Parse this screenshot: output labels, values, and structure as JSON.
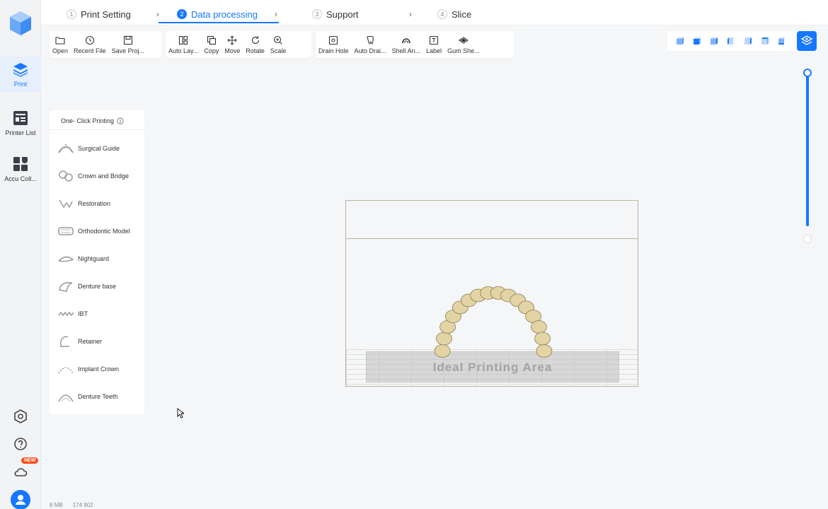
{
  "sidebar": {
    "items": [
      {
        "label": "Print",
        "icon": "print-layers-icon",
        "active": true
      },
      {
        "label": "Printer List",
        "icon": "printer-list-icon",
        "active": false
      },
      {
        "label": "Accu Coll...",
        "icon": "accu-collection-icon",
        "active": false
      }
    ],
    "bottom_icons": [
      "settings-icon",
      "help-icon",
      "cloud-icon",
      "user-avatar-icon"
    ],
    "new_badge": "NEW"
  },
  "steps": [
    {
      "num": "1",
      "label": "Print Setting",
      "active": false
    },
    {
      "num": "2",
      "label": "Data processing",
      "active": true
    },
    {
      "num": "3",
      "label": "Support",
      "active": false
    },
    {
      "num": "4",
      "label": "Slice",
      "active": false
    }
  ],
  "toolbar": {
    "group1": [
      {
        "label": "Open",
        "icon": "folder-icon"
      },
      {
        "label": "Recent File",
        "icon": "clock-icon"
      },
      {
        "label": "Save Proj...",
        "icon": "save-icon"
      }
    ],
    "group2": [
      {
        "label": "Auto Lay...",
        "icon": "auto-layout-icon"
      },
      {
        "label": "Copy",
        "icon": "copy-icon"
      },
      {
        "label": "Move",
        "icon": "move-icon"
      },
      {
        "label": "Rotate",
        "icon": "rotate-icon"
      },
      {
        "label": "Scale",
        "icon": "scale-icon"
      }
    ],
    "group3": [
      {
        "label": "Drain Hole",
        "icon": "drain-hole-icon"
      },
      {
        "label": "Auto Drai...",
        "icon": "auto-drain-icon"
      },
      {
        "label": "Shell An...",
        "icon": "shell-icon"
      },
      {
        "label": "Label",
        "icon": "label-icon"
      },
      {
        "label": "Gum She...",
        "icon": "gum-sheet-icon"
      }
    ]
  },
  "view_buttons": [
    "view-iso-icon",
    "view-front-icon",
    "view-back-icon",
    "view-left-icon",
    "view-right-icon",
    "view-top-icon",
    "view-bottom-icon"
  ],
  "one_click": {
    "title": "One- Click Printing",
    "items": [
      {
        "label": "Surgical Guide"
      },
      {
        "label": "Crown and Bridge"
      },
      {
        "label": "Restoration"
      },
      {
        "label": "Orthodontic Model"
      },
      {
        "label": "Nightguard"
      },
      {
        "label": "Denture base"
      },
      {
        "label": "IBT"
      },
      {
        "label": "Retainer"
      },
      {
        "label": "Implant Crown"
      },
      {
        "label": "Denture Teeth"
      }
    ]
  },
  "viewport": {
    "ideal_area_label": "Ideal Printing Area"
  },
  "status": {
    "memory": "8 MB",
    "triangles": "174 902"
  },
  "colors": {
    "accent": "#1677ff",
    "badge": "#ff4d1c",
    "tooth": "#e2d4a4"
  }
}
